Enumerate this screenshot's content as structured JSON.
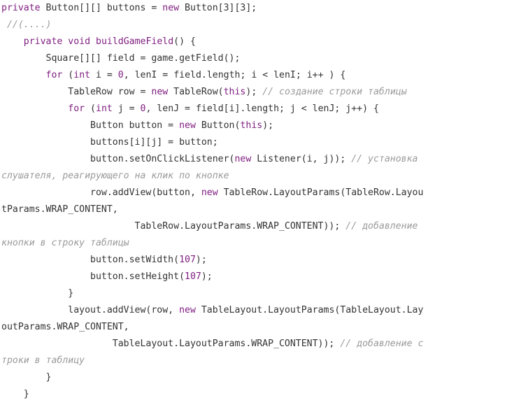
{
  "code": {
    "language": "java",
    "lines": [
      [
        {
          "t": "kw",
          "v": "private"
        },
        {
          "t": "id",
          "v": " Button[][] buttons = "
        },
        {
          "t": "kw",
          "v": "new"
        },
        {
          "t": "id",
          "v": " Button[3][3];"
        }
      ],
      [
        {
          "t": "cm",
          "v": " //(....)"
        }
      ],
      [
        {
          "t": "id",
          "v": "    "
        },
        {
          "t": "kw",
          "v": "private"
        },
        {
          "t": "id",
          "v": " "
        },
        {
          "t": "kw",
          "v": "void"
        },
        {
          "t": "id",
          "v": " "
        },
        {
          "t": "kw",
          "v": "buildGameField"
        },
        {
          "t": "id",
          "v": "() {"
        }
      ],
      [
        {
          "t": "id",
          "v": "        Square[][] field = game.getField();"
        }
      ],
      [
        {
          "t": "id",
          "v": "        "
        },
        {
          "t": "kw",
          "v": "for"
        },
        {
          "t": "id",
          "v": " ("
        },
        {
          "t": "kw",
          "v": "int"
        },
        {
          "t": "id",
          "v": " i = "
        },
        {
          "t": "num",
          "v": "0"
        },
        {
          "t": "id",
          "v": ", lenI = field.length; i < lenI; i++ ) {"
        }
      ],
      [
        {
          "t": "id",
          "v": "            TableRow row = "
        },
        {
          "t": "kw",
          "v": "new"
        },
        {
          "t": "id",
          "v": " TableRow("
        },
        {
          "t": "kw",
          "v": "this"
        },
        {
          "t": "id",
          "v": "); "
        },
        {
          "t": "cm",
          "v": "// создание строки таблицы"
        }
      ],
      [
        {
          "t": "id",
          "v": "            "
        },
        {
          "t": "kw",
          "v": "for"
        },
        {
          "t": "id",
          "v": " ("
        },
        {
          "t": "kw",
          "v": "int"
        },
        {
          "t": "id",
          "v": " j = "
        },
        {
          "t": "num",
          "v": "0"
        },
        {
          "t": "id",
          "v": ", lenJ = field[i].length; j < lenJ; j++) {"
        }
      ],
      [
        {
          "t": "id",
          "v": "                Button button = "
        },
        {
          "t": "kw",
          "v": "new"
        },
        {
          "t": "id",
          "v": " Button("
        },
        {
          "t": "kw",
          "v": "this"
        },
        {
          "t": "id",
          "v": ");"
        }
      ],
      [
        {
          "t": "id",
          "v": "                buttons[i][j] = button;"
        }
      ],
      [
        {
          "t": "id",
          "v": "                button.setOnClickListener("
        },
        {
          "t": "kw",
          "v": "new"
        },
        {
          "t": "id",
          "v": " Listener(i, j)); "
        },
        {
          "t": "cm",
          "v": "// установка"
        }
      ],
      [
        {
          "t": "cm",
          "v": "слушателя, реагирующего на клик по кнопке"
        }
      ],
      [
        {
          "t": "id",
          "v": "                row.addView(button, "
        },
        {
          "t": "kw",
          "v": "new"
        },
        {
          "t": "id",
          "v": " TableRow.LayoutParams(TableRow.Layou"
        }
      ],
      [
        {
          "t": "id",
          "v": "tParams.WRAP_CONTENT,"
        }
      ],
      [
        {
          "t": "id",
          "v": "                        TableRow.LayoutParams.WRAP_CONTENT)); "
        },
        {
          "t": "cm",
          "v": "// добавление"
        }
      ],
      [
        {
          "t": "cm",
          "v": "кнопки в строку таблицы"
        }
      ],
      [
        {
          "t": "id",
          "v": "                button.setWidth("
        },
        {
          "t": "num",
          "v": "107"
        },
        {
          "t": "id",
          "v": ");"
        }
      ],
      [
        {
          "t": "id",
          "v": "                button.setHeight("
        },
        {
          "t": "num",
          "v": "107"
        },
        {
          "t": "id",
          "v": ");"
        }
      ],
      [
        {
          "t": "id",
          "v": "            }"
        }
      ],
      [
        {
          "t": "id",
          "v": "            layout.addView(row, "
        },
        {
          "t": "kw",
          "v": "new"
        },
        {
          "t": "id",
          "v": " TableLayout.LayoutParams(TableLayout.Lay"
        }
      ],
      [
        {
          "t": "id",
          "v": "outParams.WRAP_CONTENT,"
        }
      ],
      [
        {
          "t": "id",
          "v": "                    TableLayout.LayoutParams.WRAP_CONTENT)); "
        },
        {
          "t": "cm",
          "v": "// добавление с"
        }
      ],
      [
        {
          "t": "cm",
          "v": "троки в таблицу"
        }
      ],
      [
        {
          "t": "id",
          "v": "        }"
        }
      ],
      [
        {
          "t": "id",
          "v": "    }"
        }
      ]
    ]
  },
  "colors": {
    "background": "#ffffff",
    "text": "#333333",
    "keyword": "#7f1f80",
    "number": "#7f1f80",
    "comment": "#9a9a9a"
  }
}
